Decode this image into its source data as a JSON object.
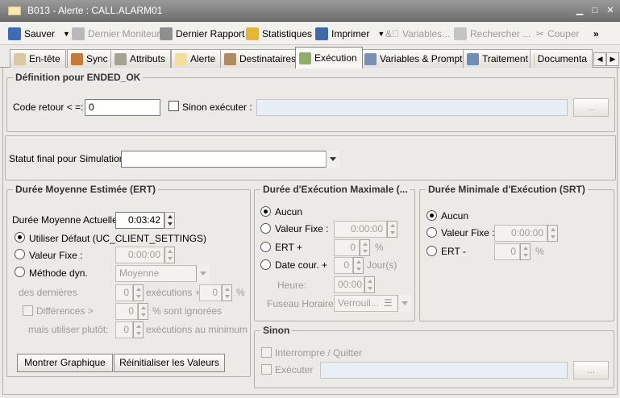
{
  "window": {
    "title": "B013 - Alerte : CALL.ALARM01"
  },
  "toolbar": {
    "save": "Sauver",
    "last_monitor": "Dernier Moniteur",
    "last_report": "Dernier Rapport",
    "stats": "Statistiques",
    "print": "Imprimer",
    "variables": "Variables...",
    "search": "Rechercher ...",
    "cut": "Couper",
    "more": "»"
  },
  "tabs": [
    "En-tête",
    "Sync",
    "Attributs",
    "Alerte",
    "Destinataires",
    "Exécution",
    "Variables & Prompts",
    "Traitement",
    "Documenta"
  ],
  "ended_ok": {
    "title": "Définition pour ENDED_OK",
    "code_label": "Code retour < =:",
    "code_value": "0",
    "else_label": "Sinon exécuter :",
    "browse": "..."
  },
  "simulation": {
    "label": "Statut final pour Simulation:",
    "value": ""
  },
  "ert": {
    "title": "Durée Moyenne Estimée (ERT)",
    "current_label": "Durée Moyenne Actuelle:",
    "current_value": "0:03:42",
    "opt_default": "Utiliser Défaut (UC_CLIENT_SETTINGS)",
    "opt_fixed": "Valeur Fixe :",
    "fixed_value": "0:00:00",
    "opt_dyn": "Méthode dyn.",
    "dyn_value": "Moyenne",
    "last_label": "des dernières",
    "last_value": "0",
    "exec_plus": "exécutions +",
    "pct_value": "0",
    "pct": "%",
    "diff_label": "Différences >",
    "diff_value": "0",
    "ignored": "% sont ignorées",
    "but_label": "mais utiliser plutôt:",
    "but_value": "0",
    "min_exec": "exécutions au minimum",
    "btn_graph": "Montrer Graphique",
    "btn_reset": "Réinitialiser les Valeurs"
  },
  "mrt": {
    "title": "Durée d'Exécution Maximale (...",
    "none": "Aucun",
    "fixed": "Valeur Fixe :",
    "fixed_value": "0:00:00",
    "ert_plus": "ERT +",
    "ert_value": "0",
    "pct": "%",
    "date_plus": "Date cour. +",
    "date_value": "0",
    "days": "Jour(s)",
    "hour_label": "Heure:",
    "hour_value": "00:00",
    "tz_label": "Fuseau Horaire:",
    "tz_value": "Verrouil..."
  },
  "srt": {
    "title": "Durée Minimale d'Exécution (SRT)",
    "none": "Aucun",
    "fixed": "Valeur Fixe :",
    "fixed_value": "0:00:00",
    "ert_minus": "ERT -",
    "ert_value": "0",
    "pct": "%"
  },
  "else": {
    "title": "Sinon",
    "abort": "Interrompre / Quitter",
    "execute": "Exécuter",
    "browse": "..."
  }
}
